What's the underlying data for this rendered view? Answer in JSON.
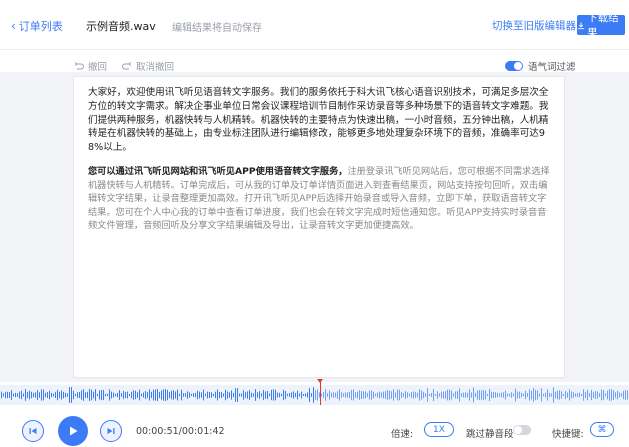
{
  "header": {
    "back_label": "订单列表",
    "file_name": "示例音频.wav",
    "autosave_text": "编辑结果将自动保存",
    "switch_label": "切换至旧版编辑器",
    "download_label": "下载结果"
  },
  "toolbar": {
    "undo_label": "撤回",
    "redo_label": "取消撤回",
    "filter_label": "语气词过滤",
    "filter_on": true
  },
  "transcript": {
    "paragraph1": "大家好，欢迎使用讯飞听见语音转文字服务。我们的服务依托于科大讯飞核心语音识别技术，可满足多层次全方位的转文字需求。解决企事业单位日常会议课程培训节目制作采访录音等多种场景下的语音转文字难题。我们提供两种服务，机器快转与人机精转。机器快转的主要特点为快速出稿，一小时音频，五分钟出稿，人机精转是在机器快转的基础上，由专业标注团队进行编辑修改，能够更多地处理复杂环境下的音频，准确率可达98%以上。",
    "paragraph2_strong": "您可以通过讯飞听见网站和讯飞听见APP使用语音转文字服务，",
    "paragraph2_muted": "注册登录讯飞听见网站后，您可根据不同需求选择机器快转与人机精转。订单完成后，可从我的订单及订单详情页面进入到查看结果页，网站支持按句回听，双击编辑转文字结果，让录音整理更加高效。打开讯飞听见APP后选择开始录音或导入音频，立即下单，获取语音转文字结果。您可在个人中心我的订单中查看订单进度，我们也会在转文字完成时短信通知您。听见APP支持实时录音音频文件管理，音频回听及分享文字结果编辑及导出，让录音转文字更加便捷高效。"
  },
  "player": {
    "time_text": "00:00:51/00:01:42",
    "speed_label": "倍速:",
    "speed_value": "1X",
    "skip_silence_label": "跳过静音段",
    "skip_silence_on": false,
    "shortcut_label": "快捷键:",
    "shortcut_value": "⌘"
  },
  "waveform": {
    "progress": 0.5
  },
  "colors": {
    "accent": "#3b7cf6",
    "playhead": "#e6332a",
    "background_band": "#f2f3f7"
  }
}
